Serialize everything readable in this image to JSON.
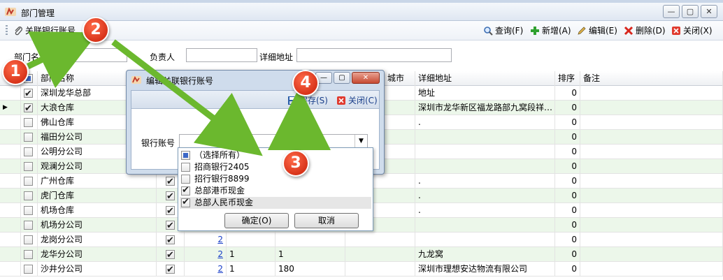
{
  "window": {
    "title": "部门管理",
    "buttons": [
      "—",
      "▢",
      "✕"
    ]
  },
  "toolbar": {
    "link_bank": "关联银行账号",
    "query": "查询(F)",
    "add": "新增(A)",
    "edit": "编辑(E)",
    "delete": "删除(D)",
    "close": "关闭(X)"
  },
  "filter": {
    "dept_name_label": "部门名称",
    "owner_label": "负责人",
    "address_label": "详细地址",
    "dept_name_value": "",
    "owner_value": "",
    "address_value": ""
  },
  "table": {
    "headers": {
      "name": "部门名称",
      "city": "城市",
      "address": "详细地址",
      "sort": "排序",
      "remark": "备注"
    },
    "rows": [
      {
        "checked": true,
        "name": "深圳龙华总部",
        "c2": false,
        "link": "",
        "c4": "",
        "c5": "",
        "address": "地址",
        "sort": "0"
      },
      {
        "checked": true,
        "name": "大浪仓库",
        "c2": false,
        "link": "",
        "c4": "",
        "c5": "",
        "address": "深圳市龙华新区福龙路部九窝段祥…",
        "sort": "0",
        "current": true
      },
      {
        "checked": false,
        "name": "佛山仓库",
        "c2": false,
        "link": "",
        "c4": "",
        "c5": "",
        "address": ".",
        "sort": "0"
      },
      {
        "checked": false,
        "name": "福田分公司",
        "c2": false,
        "link": "",
        "c4": "",
        "c5": "",
        "address": "",
        "sort": "0"
      },
      {
        "checked": false,
        "name": "公明分公司",
        "c2": false,
        "link": "",
        "c4": "",
        "c5": "",
        "address": "",
        "sort": "0"
      },
      {
        "checked": false,
        "name": "观澜分公司",
        "c2": false,
        "link": "",
        "c4": "",
        "c5": "",
        "address": "",
        "sort": "0"
      },
      {
        "checked": false,
        "name": "广州仓库",
        "c2": true,
        "link": "",
        "c4": "",
        "c5": "",
        "address": ".",
        "sort": "0"
      },
      {
        "checked": false,
        "name": "虎门仓库",
        "c2": true,
        "link": "",
        "c4": "",
        "c5": "",
        "address": ".",
        "sort": "0"
      },
      {
        "checked": false,
        "name": "机场仓库",
        "c2": true,
        "link": "",
        "c4": "",
        "c5": "",
        "address": ".",
        "sort": "0"
      },
      {
        "checked": false,
        "name": "机场分公司",
        "c2": true,
        "link": "",
        "c4": "",
        "c5": "",
        "address": "",
        "sort": "0"
      },
      {
        "checked": false,
        "name": "龙岗分公司",
        "c2": true,
        "link": "2",
        "c4": "",
        "c5": "",
        "address": "",
        "sort": "0"
      },
      {
        "checked": false,
        "name": "龙华分公司",
        "c2": true,
        "link": "2",
        "c4": "1",
        "c5": "1",
        "address": "九龙窝",
        "sort": "0"
      },
      {
        "checked": false,
        "name": "沙井分公司",
        "c2": true,
        "link": "2",
        "c4": "1",
        "c5": "180",
        "address": "深圳市理想安达物流有限公司",
        "sort": "0"
      }
    ]
  },
  "dialog": {
    "title": "编辑关联银行账号",
    "save": "保存(S)",
    "close": "关闭(C)",
    "bank_label": "银行账号",
    "bank_value": ""
  },
  "dropdown": {
    "options": [
      {
        "label": "（选择所有）",
        "state": "partial"
      },
      {
        "label": "招商银行2405",
        "state": "unchecked"
      },
      {
        "label": "招行银行8899",
        "state": "unchecked"
      },
      {
        "label": "总部港币现金",
        "state": "checked"
      },
      {
        "label": "总部人民币现金",
        "state": "checked"
      }
    ],
    "ok": "确定(O)",
    "cancel": "取消"
  },
  "annotations": {
    "badges": [
      "1",
      "2",
      "3",
      "4"
    ],
    "arrow_color": "#6bb82e",
    "badge_color": "#e0391c"
  },
  "colors": {
    "alt_row": "#ecf7ea",
    "link": "#1a3fc8"
  }
}
